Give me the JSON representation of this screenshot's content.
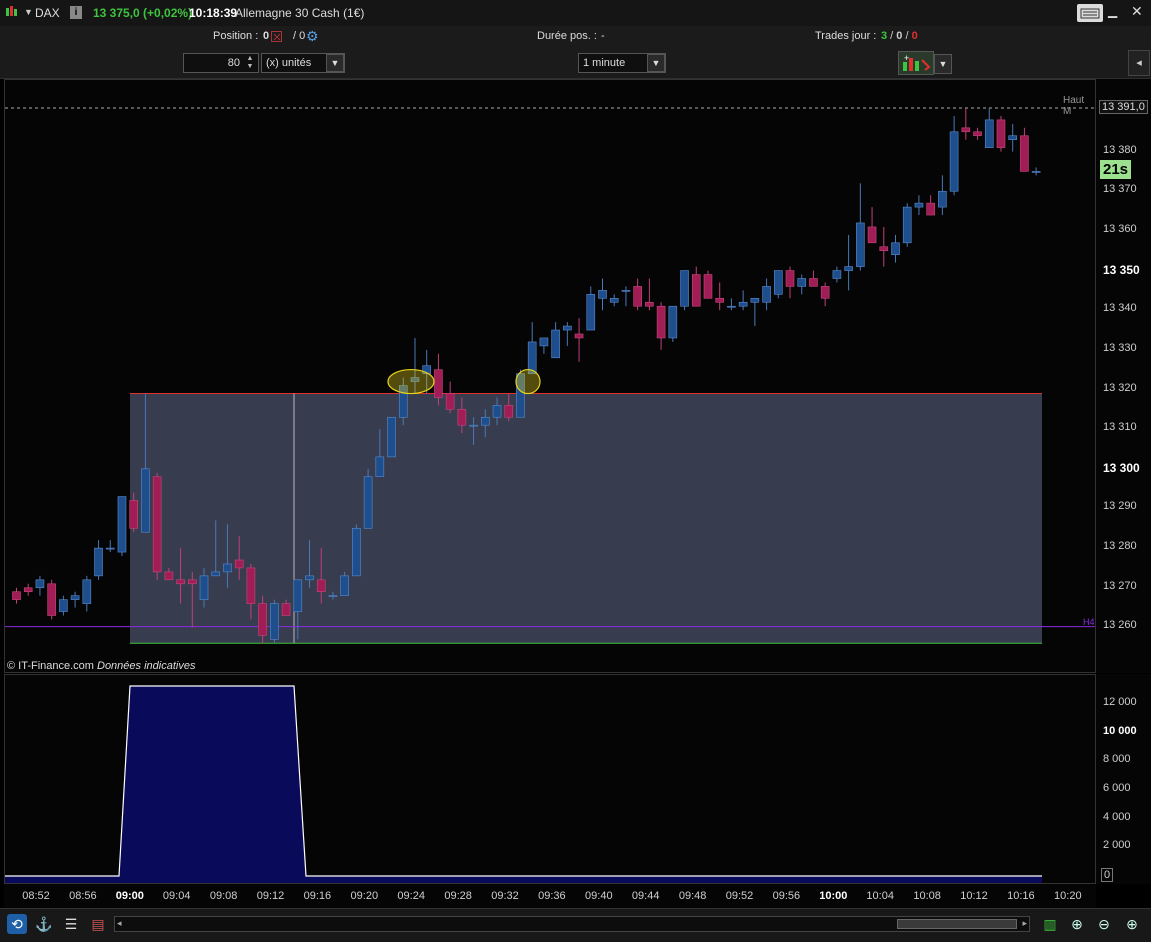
{
  "titlebar": {
    "symbol": "DAX",
    "price_change": "13 375,0 (+0,02%)",
    "time": "10:18:39",
    "instrument": "Allemagne 30 Cash (1€)"
  },
  "infobar": {
    "position_label": "Position :",
    "position_value": "0",
    "position_sep": "/ 0",
    "duration_label": "Durée pos. :",
    "duration_value": "-",
    "trades_label": "Trades jour :",
    "trades_win": "3",
    "trades_slash1": " / ",
    "trades_neutral": "0",
    "trades_slash2": " / ",
    "trades_loss": "0"
  },
  "toolbar": {
    "quantity": "80",
    "units_label": "(x) unités",
    "timeframe": "1 minute"
  },
  "chart": {
    "credit": "© IT-Finance.com",
    "disclaimer": "Données indicatives",
    "haut_label": "Haut M",
    "haut_value": "13 391,0",
    "countdown": "21s",
    "h4_label": "H4",
    "price_ticks": [
      "13 380",
      "13 370",
      "13 360",
      "13 350",
      "13 340",
      "13 330",
      "13 320",
      "13 310",
      "13 300",
      "13 290",
      "13 280",
      "13 270",
      "13 260"
    ],
    "volume_ticks": [
      "12 000",
      "10 000",
      "8 000",
      "6 000",
      "4 000",
      "2 000",
      "0"
    ],
    "time_ticks": [
      "08:52",
      "08:56",
      "09:00",
      "09:04",
      "09:08",
      "09:12",
      "09:16",
      "09:20",
      "09:24",
      "09:28",
      "09:32",
      "09:36",
      "09:40",
      "09:44",
      "09:48",
      "09:52",
      "09:56",
      "10:00",
      "10:04",
      "10:08",
      "10:12",
      "10:16",
      "10:20"
    ]
  },
  "colors": {
    "up": "#1e4f8c",
    "down": "#a01e55",
    "positive": "#3ec43e",
    "negative": "#e03030",
    "volume_fill": "#0a0a5a",
    "range_box": "#3a3f52",
    "highlight": "#e8d21a"
  }
}
